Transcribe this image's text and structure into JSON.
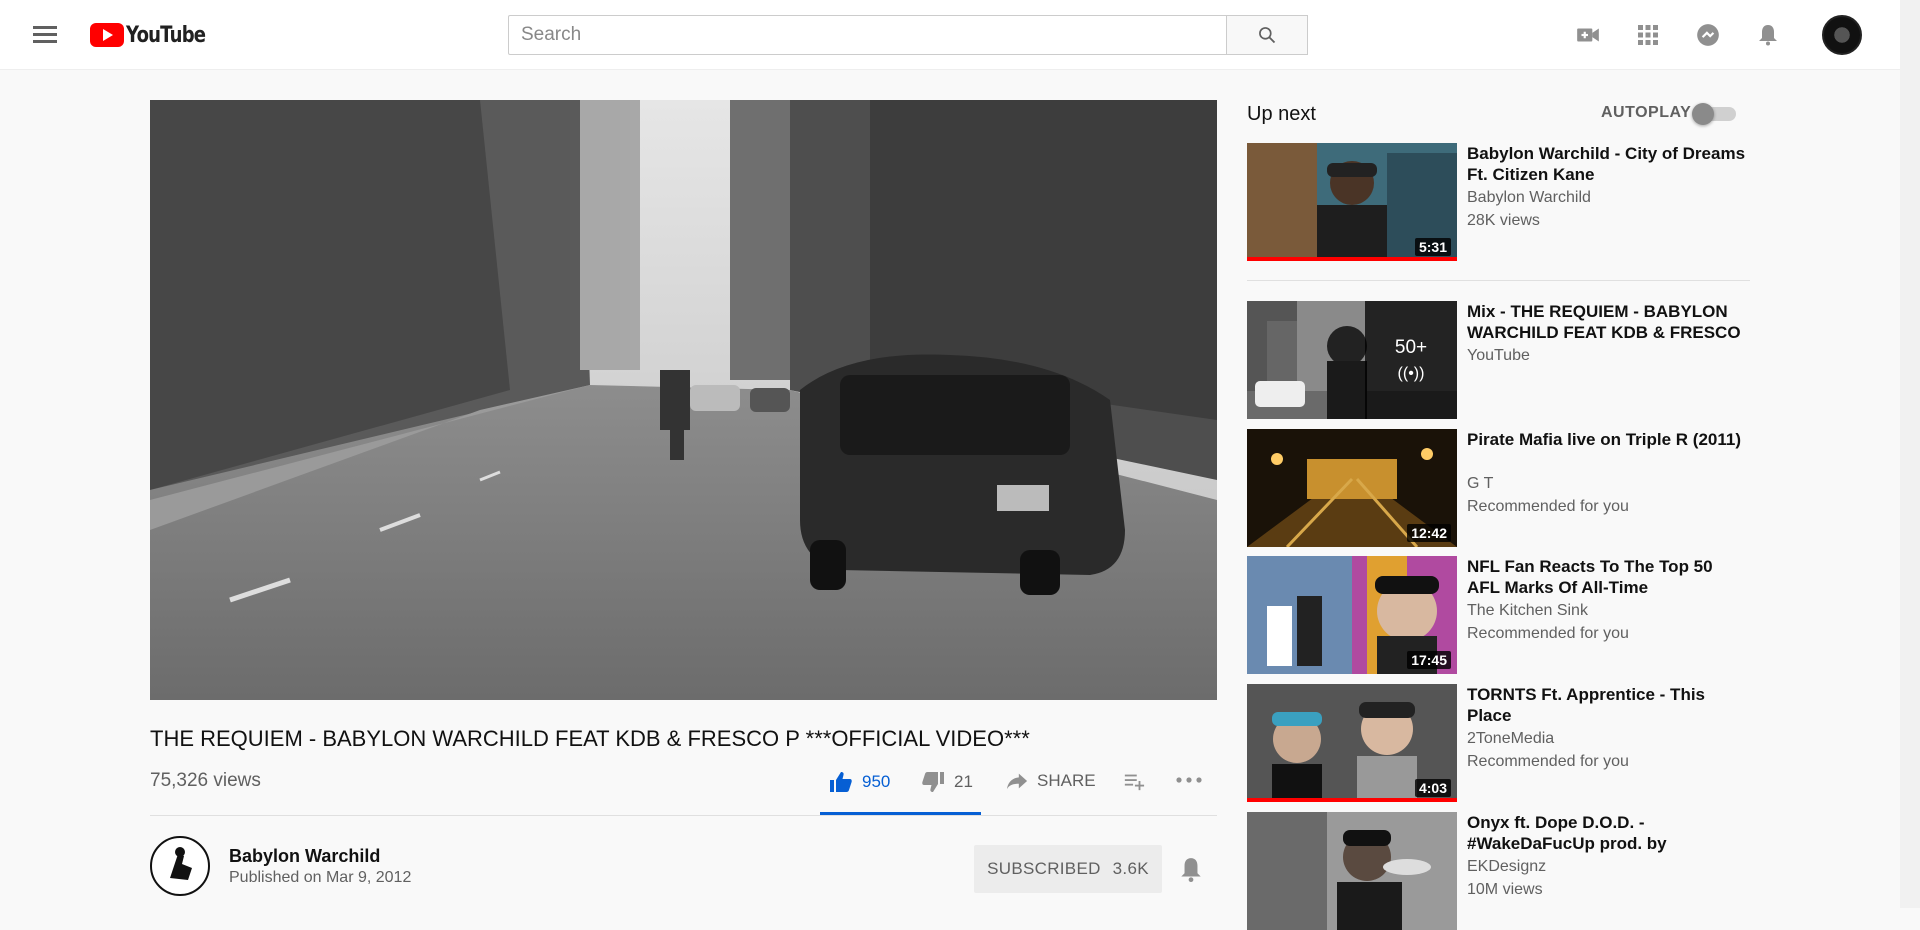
{
  "masthead": {
    "logo_text": "YouTube",
    "search_placeholder": "Search",
    "icons": [
      "menu-icon",
      "search-icon",
      "create-video-icon",
      "apps-icon",
      "messages-icon",
      "notifications-icon"
    ]
  },
  "video": {
    "title": "THE REQUIEM - BABYLON WARCHILD FEAT KDB & FRESCO P ***OFFICIAL VIDEO***",
    "views": "75,326 views",
    "likes": "950",
    "dislikes": "21",
    "share_label": "SHARE",
    "like_ratio": 0.978
  },
  "owner": {
    "name": "Babylon Warchild",
    "published": "Published on Mar 9, 2012",
    "subscribe_label": "SUBSCRIBED",
    "subscriber_count": "3.6K"
  },
  "sidebar": {
    "up_next_label": "Up next",
    "autoplay_label": "AUTOPLAY",
    "autoplay_on": false,
    "items": [
      {
        "title": "Babylon Warchild - City of Dreams Ft. Citizen Kane",
        "channel": "Babylon Warchild",
        "meta": "28K views",
        "duration": "5:31",
        "watched": true
      },
      {
        "title": "Mix - THE REQUIEM - BABYLON WARCHILD FEAT KDB & FRESCO P",
        "channel": "YouTube",
        "meta": "",
        "mix_count": "50+"
      },
      {
        "title": "Pirate Mafia live on Triple R (2011)",
        "channel": "G T",
        "meta": "Recommended for you",
        "duration": "12:42"
      },
      {
        "title": "NFL Fan Reacts To The Top 50 AFL Marks Of All-Time",
        "channel": "The Kitchen Sink",
        "meta": "Recommended for you",
        "duration": "17:45"
      },
      {
        "title": "TORNTS Ft. Apprentice - This Place",
        "channel": "2ToneMedia",
        "meta": "Recommended for you",
        "duration": "4:03",
        "watched": true
      },
      {
        "title": "Onyx ft. Dope D.O.D. - #WakeDaFucUp prod. by",
        "channel": "EKDesignz",
        "meta": "10M views"
      }
    ]
  }
}
